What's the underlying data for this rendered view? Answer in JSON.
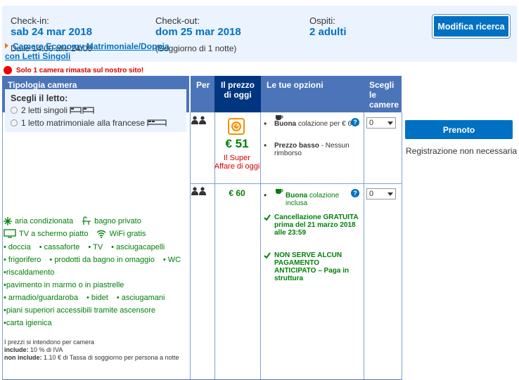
{
  "summary": {
    "checkin_label": "Check-in:",
    "checkin_value": "sab 24 mar 2018",
    "checkin_note": "Dalle 14:00 alle 24:00",
    "checkout_label": "Check-out:",
    "checkout_value": "dom 25 mar 2018",
    "checkout_note": "(Soggiorno di 1 notte)",
    "guests_label": "Ospiti:",
    "guests_value": "2 adulti",
    "modify_button": "Modifica ricerca"
  },
  "table": {
    "headers": {
      "room_type": "Tipologia camera",
      "per": "Per",
      "today_price_1": "Il prezzo",
      "today_price_2": "di oggi",
      "options": "Le tue opzioni",
      "choose_1": "Scegli",
      "choose_2": "le",
      "choose_3": "camere"
    }
  },
  "room": {
    "name": "Camera Economy Matrimoniale/Doppia con Letti Singoli",
    "warning": "Solo 1 camera rimasta sul nostro sito!",
    "bed_title": "Scegli il letto:",
    "bed_option_1": "2 letti singoli",
    "bed_option_2": "1 letto matrimoniale alla francese",
    "facilities": {
      "ac": "aria condizionata",
      "bath": "bagno privato",
      "tv_flat": "TV a schermo piatto",
      "wifi": "WiFi gratis",
      "shower": "doccia",
      "safe": "cassaforte",
      "tv": "TV",
      "hairdryer": "asciugacapelli",
      "fridge": "frigorifero",
      "toiletries": "prodotti da bagno in omaggio",
      "wc": "WC",
      "heating": "riscaldamento",
      "floor": "pavimento in marmo o in piastrelle",
      "wardrobe": "armadio/guardaroba",
      "bidet": "bidet",
      "towels": "asciugamani",
      "lift": "piani superiori accessibili tramite ascensore",
      "paper": "carta igienica"
    },
    "fine_print_1": "I prezzi si intendono per camera",
    "fine_include_label": "include:",
    "fine_include_text": "10 % di IVA",
    "fine_exclude_label": "non include:",
    "fine_exclude_text": "1.10 € di Tassa di soggiorno per persona a notte"
  },
  "option1": {
    "price": "€ 51",
    "deal": "Il Super Affare di oggi",
    "breakfast_bold": "Buona",
    "breakfast_text": "colazione per € 6",
    "refund_bold": "Prezzo basso",
    "refund_text": "- Nessun rimborso",
    "qty": "0"
  },
  "option2": {
    "price": "€ 60",
    "breakfast_bold": "Buona",
    "breakfast_text": "colazione inclusa",
    "cancel": "Cancellazione GRATUITA prima del 21 marzo 2018 alle 23:59",
    "nopay": "NON SERVE ALCUN PAGAMENTO ANTICIPATO – Paga in struttura",
    "qty": "0"
  },
  "booking": {
    "book_button": "Prenoto",
    "no_registration": "Registrazione non necessaria"
  },
  "colors": {
    "brand_blue": "#0071c2",
    "header_blue": "#4b75b8",
    "dark_blue": "#003580",
    "green": "#008009",
    "red": "#d60000"
  }
}
